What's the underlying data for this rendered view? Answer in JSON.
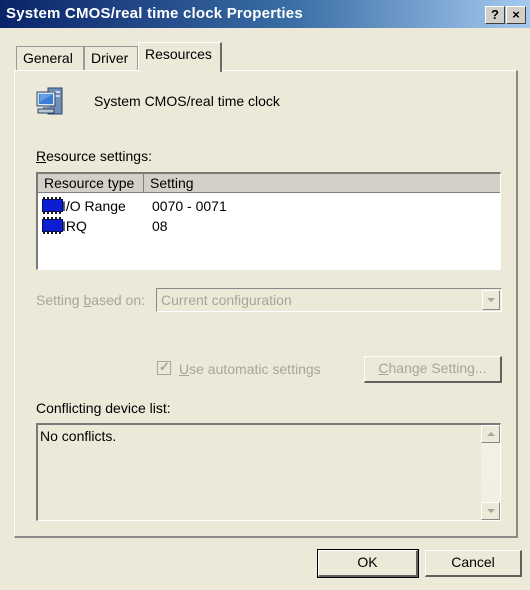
{
  "window": {
    "title": "System CMOS/real time clock Properties",
    "help_label": "?",
    "close_label": "×"
  },
  "tabs": [
    {
      "label": "General",
      "selected": false
    },
    {
      "label": "Driver",
      "selected": false
    },
    {
      "label": "Resources",
      "selected": true
    }
  ],
  "device": {
    "icon": "computer-device-icon",
    "name": "System CMOS/real time clock"
  },
  "resources": {
    "label_underlined": "R",
    "label_rest": "esource settings:",
    "columns": [
      "Resource type",
      "Setting"
    ],
    "rows": [
      {
        "icon": "hardware-resource-icon",
        "type": "I/O Range",
        "setting": "0070 - 0071"
      },
      {
        "icon": "hardware-resource-icon",
        "type": "IRQ",
        "setting": "08"
      }
    ]
  },
  "setting_based_on": {
    "label_pre": "Setting ",
    "label_underlined": "b",
    "label_post": "ased on:",
    "value": "Current configuration"
  },
  "auto_settings": {
    "checked": true,
    "label_underlined": "U",
    "label_rest": "se automatic settings"
  },
  "change_setting": {
    "label_underlined": "C",
    "label_rest": "hange Setting..."
  },
  "conflicts": {
    "label": "Conflicting device list:",
    "text": "No conflicts."
  },
  "buttons": {
    "ok": "OK",
    "cancel": "Cancel"
  },
  "colors": {
    "title_gradient_start": "#0a246a",
    "dialog_background": "#ece9d8",
    "disabled_text": "#a8a59a",
    "resource_icon": "#0b1fd0"
  }
}
